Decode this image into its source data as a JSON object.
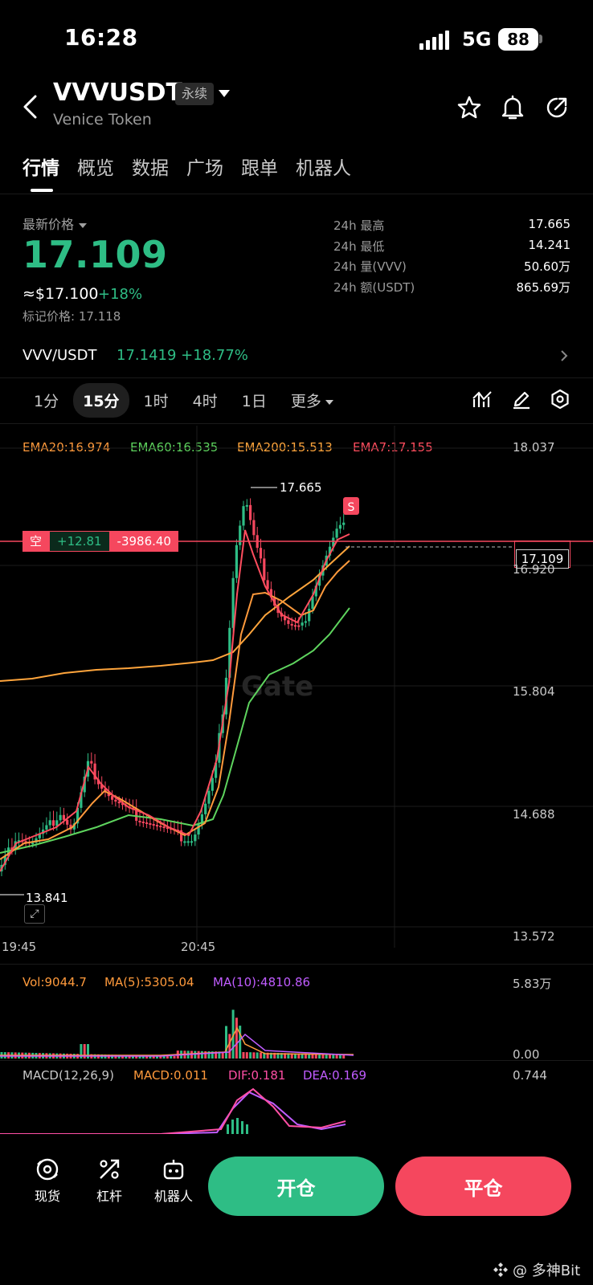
{
  "status_bar": {
    "time": "16:28",
    "network": "5G",
    "battery": "88"
  },
  "header": {
    "symbol": "VVVUSDT",
    "badge": "永续",
    "name": "Venice Token",
    "icons": [
      "star-icon",
      "bell-icon",
      "share-icon"
    ]
  },
  "tabs": [
    "行情",
    "概览",
    "数据",
    "广场",
    "跟单",
    "机器人"
  ],
  "price": {
    "label": "最新价格",
    "last": "17.109",
    "usd": "≈$17.100",
    "change": "+18%",
    "mark_label": "标记价格:",
    "mark": "17.118"
  },
  "stats": [
    {
      "k": "24h  最高",
      "v": "17.665"
    },
    {
      "k": "24h  最低",
      "v": "14.241"
    },
    {
      "k": "24h  量(VVV)",
      "v": "50.60万"
    },
    {
      "k": "24h  额(USDT)",
      "v": "865.69万"
    }
  ],
  "pair": {
    "name": "VVV/USDT",
    "price": "17.1419",
    "change": "+18.77%"
  },
  "timeframes": [
    "1分",
    "15分",
    "1时",
    "4时",
    "1日",
    "更多"
  ],
  "ema": {
    "ema20": "EMA20:16.974",
    "ema60": "EMA60:16.535",
    "ema200": "EMA200:15.513",
    "ema7": "EMA7:17.155"
  },
  "colors": {
    "up": "#2ebd85",
    "down": "#f5475e",
    "ema20": "#ff9a3c",
    "ema60": "#5ed45e",
    "ema200": "#ffa53c",
    "ema7": "#ff4d5e",
    "ma10": "#c05cff",
    "dif": "#ff4fa5"
  },
  "chart_data": {
    "type": "candlestick",
    "y_ticks": [
      "18.037",
      "16.920",
      "15.804",
      "14.688",
      "13.572"
    ],
    "x_ticks": [
      "19:45",
      "20:45"
    ],
    "high_marker": "17.665",
    "low_marker": "13.841",
    "current_price": "17.109",
    "position": {
      "side": "空",
      "qty": "+12.81",
      "pnl": "-3986.40"
    },
    "signal": "S",
    "watermark": "Gate",
    "ylim": [
      13.572,
      18.037
    ]
  },
  "volume": {
    "vol": "Vol:9044.7",
    "ma5": "MA(5):5305.04",
    "ma10": "MA(10):4810.86",
    "top": "5.83万",
    "bottom": "0.00"
  },
  "macd": {
    "label": "MACD(12,26,9)",
    "macd": "MACD:0.011",
    "dif": "DIF:0.181",
    "dea": "DEA:0.169",
    "top": "0.744"
  },
  "bottom_nav": [
    {
      "label": "现货",
      "icon": "spot-icon"
    },
    {
      "label": "杠杆",
      "icon": "leverage-icon"
    },
    {
      "label": "机器人",
      "icon": "robot-icon"
    }
  ],
  "buttons": {
    "open": "开仓",
    "close": "平仓"
  },
  "watermark": {
    "text": "@ 多神Bit"
  }
}
